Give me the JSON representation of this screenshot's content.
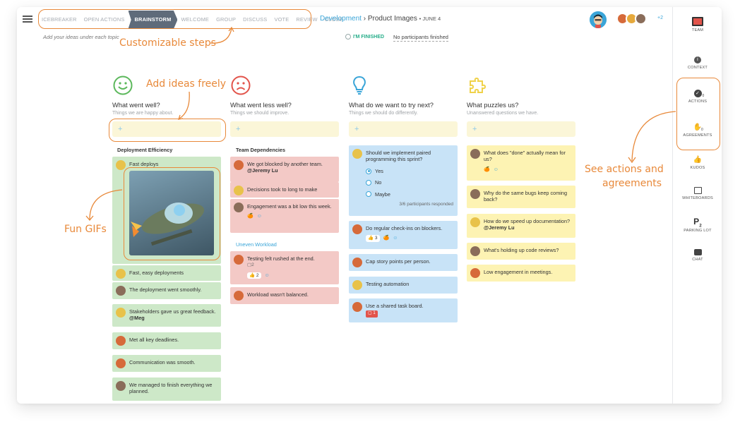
{
  "steps": [
    "ICEBREAKER",
    "OPEN ACTIONS",
    "BRAINSTORM",
    "WELCOME",
    "GROUP",
    "DISCUSS",
    "VOTE",
    "REVIEW",
    "CLOSE"
  ],
  "active_step": "BRAINSTORM",
  "steps_hint": "Add your ideas under each topic",
  "breadcrumb": {
    "project": "Development",
    "separator": "›",
    "page": "Product Images",
    "date": "• JUNE 4"
  },
  "finished_label": "I'M FINISHED",
  "participants_status": "No participants finished",
  "team_more": "+2",
  "sidebar": [
    {
      "label": "TEAM",
      "icon": "team-icon"
    },
    {
      "label": "CONTEXT",
      "icon": "info-icon"
    },
    {
      "label": "ACTIONS",
      "icon": "check-circle-icon",
      "count": "0"
    },
    {
      "label": "AGREEMENTS",
      "icon": "handshake-icon",
      "count": "0"
    },
    {
      "label": "KUDOS",
      "icon": "kudos-icon"
    },
    {
      "label": "WHITEBOARDS",
      "icon": "whiteboard-icon"
    },
    {
      "label": "PARKING LOT",
      "icon": "parking-icon",
      "sub": "2"
    },
    {
      "label": "CHAT",
      "icon": "chat-icon"
    }
  ],
  "columns": [
    {
      "title": "What went well?",
      "subtitle": "Things we are happy about.",
      "icon": "smiley-icon",
      "color": "#5cb85c"
    },
    {
      "title": "What went less well?",
      "subtitle": "Things we should improve.",
      "icon": "sad-face-icon",
      "color": "#e2544b"
    },
    {
      "title": "What do we want to try next?",
      "subtitle": "Things we should do differently.",
      "icon": "lightbulb-icon",
      "color": "#3aa5d8"
    },
    {
      "title": "What puzzles us?",
      "subtitle": "Unanswered questions we have.",
      "icon": "puzzle-icon",
      "color": "#f0d24a"
    }
  ],
  "add_label": "+",
  "col1": {
    "group": "Deployment Efficiency",
    "gif_card": "Fast deploys",
    "cards": [
      "Fast, easy deployments",
      "The deployment went smoothly.",
      "Stakeholders gave us great feedback.",
      "Met all key deadlines.",
      "Communication was smooth.",
      "We managed to finish everything we planned."
    ],
    "mention": "@Meg"
  },
  "col2": {
    "group1": "Team Dependencies",
    "cards1": [
      "We got blocked by another team.",
      "Decisions took to long to make",
      "Engagement was a bit low this week."
    ],
    "mention": "@Jeremy Lu",
    "group2": "Uneven Workload",
    "cards2": [
      "Testing felt rushed at the end.",
      "Workload wasn't balanced."
    ],
    "comment_count": "2",
    "vote_count": "2"
  },
  "col3": {
    "poll_question": "Should we implement paired programming this sprint?",
    "poll_options": [
      "Yes",
      "No",
      "Maybe"
    ],
    "poll_status": "3/6 participants responded",
    "cards": [
      "Do regular check-ins on blockers.",
      "Cap story points per person.",
      "Testing automation",
      "Use a shared task board."
    ],
    "vote_count": "3",
    "badge": "1"
  },
  "col4": {
    "cards": [
      "What does \"done\" actually mean for us?",
      "Why do the same bugs keep coming back?",
      "How do we speed up documentation?",
      "What's holding up code reviews?",
      "Low engagement in meetings."
    ],
    "mention": "@Jeremy Lu"
  },
  "annotations": {
    "steps": "Customizable steps",
    "ideas": "Add ideas freely",
    "gifs": "Fun GIFs",
    "actions1": "See actions and",
    "actions2": "agreements"
  },
  "accent": "#e8893a"
}
